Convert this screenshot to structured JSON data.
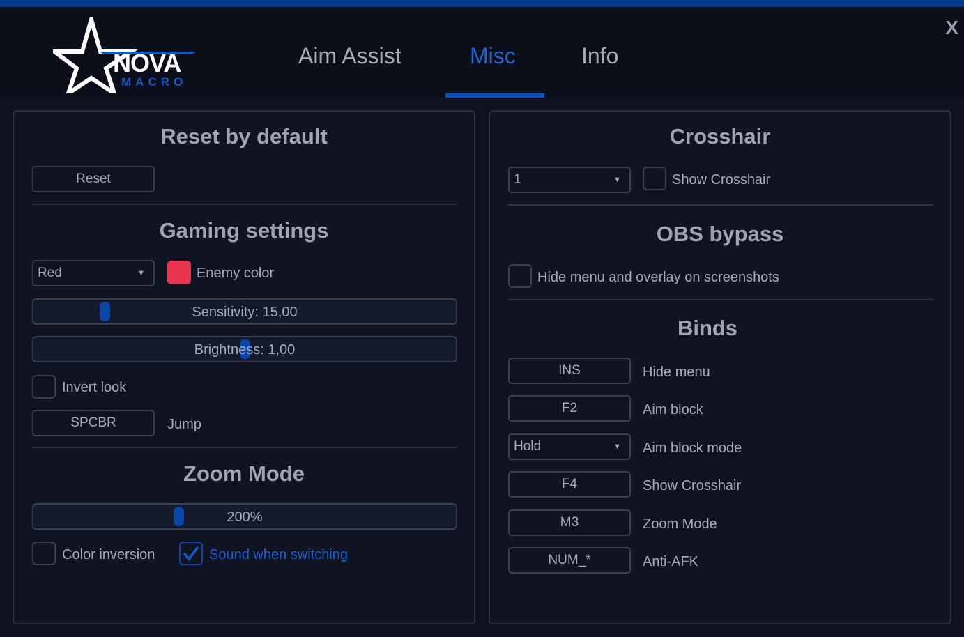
{
  "window": {
    "close": "X"
  },
  "logo": {
    "word": "NOVA",
    "sub": "MACRO"
  },
  "tabs": [
    {
      "label": "Aim Assist"
    },
    {
      "label": "Misc"
    },
    {
      "label": "Info"
    }
  ],
  "active_tab": "Misc",
  "left": {
    "reset_title": "Reset by default",
    "reset_button": "Reset",
    "gaming_title": "Gaming settings",
    "enemy_color_select": "Red",
    "enemy_color_label": "Enemy color",
    "enemy_color": "#e8344f",
    "sensitivity": {
      "label": "Sensitivity: 15,00",
      "position": 0.16
    },
    "brightness": {
      "label": "Brightness: 1,00",
      "position": 0.5
    },
    "invert_look": {
      "label": "Invert look",
      "checked": false
    },
    "jump_key": "SPCBR",
    "jump_label": "Jump",
    "zoom_title": "Zoom Mode",
    "zoom": {
      "label": "200%",
      "position": 0.34
    },
    "color_inversion": {
      "label": "Color inversion",
      "checked": false
    },
    "sound_switching": {
      "label": "Sound when switching",
      "checked": true
    }
  },
  "right": {
    "crosshair_title": "Crosshair",
    "crosshair_select": "1",
    "show_crosshair": {
      "label": "Show Crosshair",
      "checked": false
    },
    "obs_title": "OBS bypass",
    "hide_overlay": {
      "label": "Hide menu and overlay on screenshots",
      "checked": false
    },
    "binds_title": "Binds",
    "binds": [
      {
        "key": "INS",
        "label": "Hide menu",
        "type": "button"
      },
      {
        "key": "F2",
        "label": "Aim block",
        "type": "button"
      },
      {
        "key": "Hold",
        "label": "Aim block mode",
        "type": "select"
      },
      {
        "key": "F4",
        "label": "Show Crosshair",
        "type": "button"
      },
      {
        "key": "M3",
        "label": "Zoom Mode",
        "type": "button"
      },
      {
        "key": "NUM_*",
        "label": "Anti-AFK",
        "type": "button"
      }
    ]
  },
  "colors": {
    "accent": "#0a50c8",
    "topbar": "#003a8c",
    "bg": "#0e1220"
  }
}
